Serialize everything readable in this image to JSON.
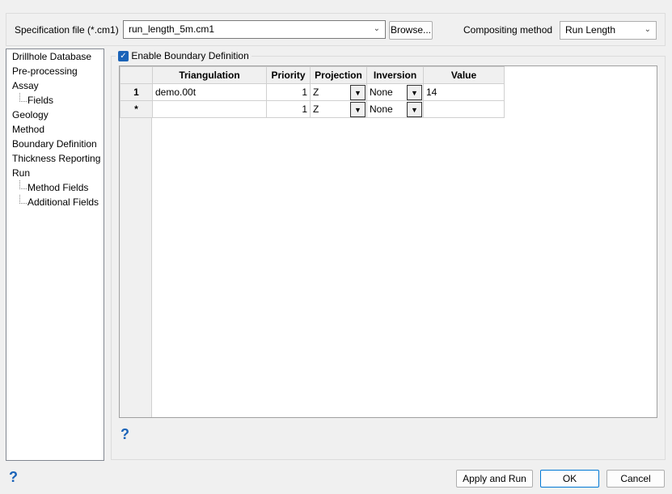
{
  "spec": {
    "label": "Specification file (*.cm1)",
    "value": "run_length_5m.cm1",
    "browse": "Browse..."
  },
  "compositing": {
    "label": "Compositing method",
    "value": "Run Length"
  },
  "tree": [
    "Drillhole Database",
    "Pre-processing",
    "Assay",
    "Fields",
    "Geology",
    "Method",
    "Boundary Definition",
    "Thickness Reporting",
    "Run",
    "Method Fields",
    "Additional Fields"
  ],
  "boundary": {
    "enable_label": "Enable Boundary Definition",
    "checked": true
  },
  "grid": {
    "headers": [
      "Triangulation",
      "Priority",
      "Projection",
      "Inversion",
      "Value"
    ],
    "rows": [
      {
        "id": "1",
        "triangulation": "demo.00t",
        "priority": "1",
        "projection": "Z",
        "inversion": "None",
        "value": "14"
      },
      {
        "id": "*",
        "triangulation": "",
        "priority": "1",
        "projection": "Z",
        "inversion": "None",
        "value": ""
      }
    ]
  },
  "help": "?",
  "buttons": {
    "apply": "Apply and Run",
    "ok": "OK",
    "cancel": "Cancel"
  }
}
